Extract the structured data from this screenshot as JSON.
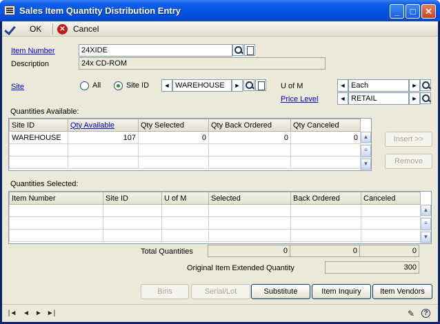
{
  "window": {
    "title": "Sales Item Quantity Distribution Entry"
  },
  "toolbar": {
    "ok_label": "OK",
    "cancel_label": "Cancel"
  },
  "form": {
    "item_number_label": "Item Number",
    "item_number_value": "24XIDE",
    "description_label": "Description",
    "description_value": "24x CD-ROM",
    "site_label": "Site",
    "radio_all_label": "All",
    "radio_siteid_label": "Site ID",
    "site_value": "WAREHOUSE",
    "uofm_label": "U of M",
    "uofm_value": "Each",
    "price_level_label": "Price Level",
    "price_level_value": "RETAIL"
  },
  "available": {
    "section_label": "Quantities Available:",
    "headers": [
      "Site ID",
      "Qty Available",
      "Qty Selected",
      "Qty Back Ordered",
      "Qty Canceled"
    ],
    "row": [
      "WAREHOUSE",
      "107",
      "0",
      "0",
      "0"
    ]
  },
  "selected": {
    "section_label": "Quantities Selected:",
    "headers": [
      "Item Number",
      "Site ID",
      "U of M",
      "Selected",
      "Back Ordered",
      "Canceled"
    ]
  },
  "totals": {
    "label": "Total Quantities",
    "selected": "0",
    "back_ordered": "0",
    "canceled": "0",
    "original_label": "Original Item Extended Quantity",
    "original_value": "300"
  },
  "buttons": {
    "insert": "Insert >>",
    "remove": "Remove",
    "bins": "Bins",
    "serial_lot": "Serial/Lot",
    "substitute": "Substitute",
    "item_inquiry": "Item Inquiry",
    "item_vendors": "Item Vendors"
  },
  "titlebar_buttons": {
    "minimize": "_",
    "maximize": "□",
    "close": "✕"
  },
  "nav": {
    "first": "|◄",
    "prev": "◄",
    "next": "►",
    "last": "►|"
  },
  "colors": {
    "titlebar": "#0053e0",
    "client": "#ece9d8",
    "link": "#0000cc"
  }
}
